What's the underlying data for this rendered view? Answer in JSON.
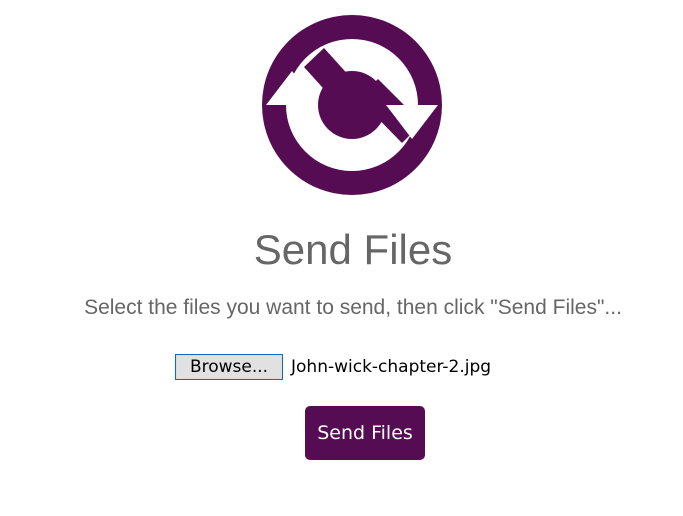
{
  "logo": {
    "icon": "sync-arrows-icon",
    "color": "#560c52"
  },
  "page": {
    "title": "Send Files",
    "instructions": "Select the files you want to send, then click \"Send Files\"..."
  },
  "file_input": {
    "button_label": "Browse...",
    "selected_file": "John-wick-chapter-2.jpg"
  },
  "actions": {
    "send_label": "Send Files"
  },
  "colors": {
    "brand": "#560c52",
    "text_muted": "#666666"
  }
}
